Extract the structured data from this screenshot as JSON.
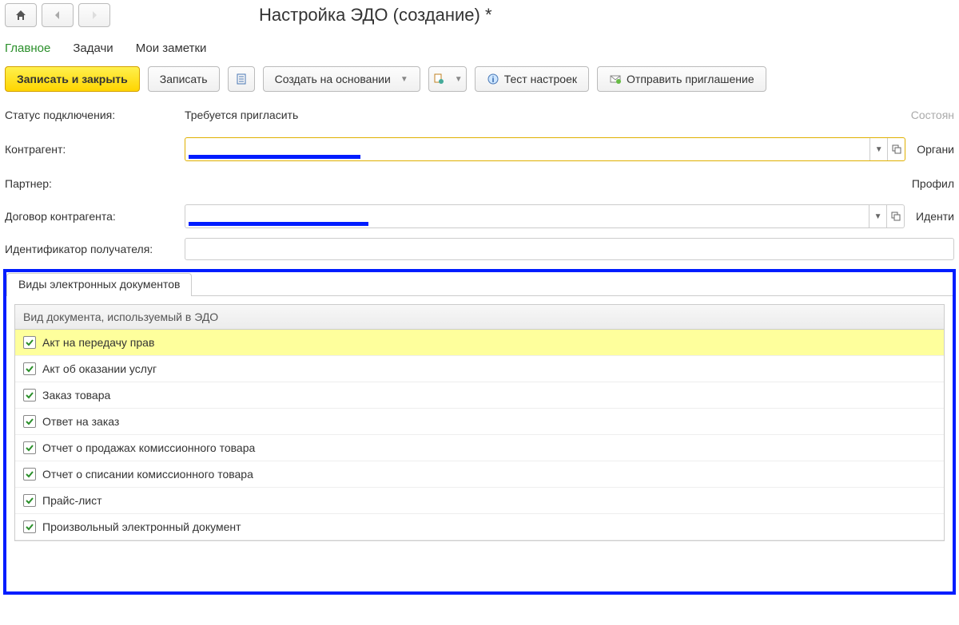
{
  "header": {
    "title": "Настройка ЭДО (создание) *"
  },
  "topTabs": {
    "items": [
      {
        "label": "Главное",
        "active": true
      },
      {
        "label": "Задачи",
        "active": false
      },
      {
        "label": "Мои заметки",
        "active": false
      }
    ]
  },
  "toolbar": {
    "save_close": "Записать и закрыть",
    "save": "Записать",
    "create_based": "Создать на основании",
    "test_settings": "Тест настроек",
    "send_invite": "Отправить приглашение"
  },
  "form": {
    "status_label": "Статус подключения:",
    "status_value": "Требуется пригласить",
    "status_side": "Состоян",
    "contragent_label": "Контрагент:",
    "contragent_side": "Органи",
    "partner_label": "Партнер:",
    "partner_side": "Профил",
    "contract_label": "Договор контрагента:",
    "contract_side": "Иденти",
    "recipient_id_label": "Идентификатор получателя:"
  },
  "subTabs": {
    "tab1": "Виды электронных документов"
  },
  "grid": {
    "header": "Вид документа, используемый в ЭДО",
    "rows": [
      {
        "label": "Акт на передачу прав",
        "checked": true,
        "selected": true
      },
      {
        "label": "Акт об оказании услуг",
        "checked": true,
        "selected": false
      },
      {
        "label": "Заказ товара",
        "checked": true,
        "selected": false
      },
      {
        "label": "Ответ на заказ",
        "checked": true,
        "selected": false
      },
      {
        "label": "Отчет о продажах комиссионного товара",
        "checked": true,
        "selected": false
      },
      {
        "label": "Отчет о списании комиссионного товара",
        "checked": true,
        "selected": false
      },
      {
        "label": "Прайс-лист",
        "checked": true,
        "selected": false
      },
      {
        "label": "Произвольный электронный документ",
        "checked": true,
        "selected": false
      }
    ]
  }
}
